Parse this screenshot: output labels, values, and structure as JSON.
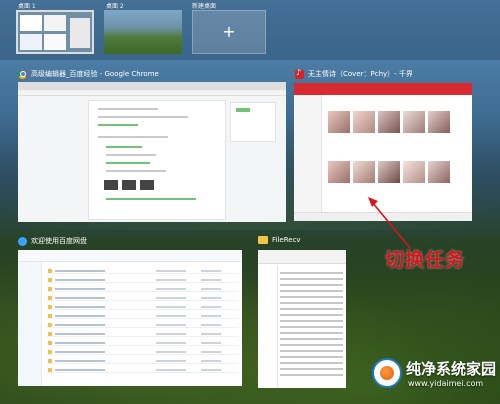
{
  "desktops": [
    {
      "label": "桌面 1",
      "active": true
    },
    {
      "label": "桌面 2",
      "active": false
    },
    {
      "label": "新建桌面",
      "icon": "plus-icon"
    }
  ],
  "windows": {
    "chrome": {
      "title": "高级编辑器_百度经验 - Google Chrome",
      "icon": "chrome-icon"
    },
    "music": {
      "title": "无主情诗（Cover：Pchy）- 千界",
      "icon": "netease-music-icon"
    },
    "netdisk": {
      "title": "欢迎使用百度网盘",
      "icon": "baidu-netdisk-icon"
    },
    "explorer": {
      "title": "FileRecv",
      "icon": "folder-icon"
    }
  },
  "annotation": {
    "text": "切换任务",
    "color": "#d8141c"
  },
  "watermark": {
    "title": "纯净系统家园",
    "url": "www.yidaimei.com"
  }
}
